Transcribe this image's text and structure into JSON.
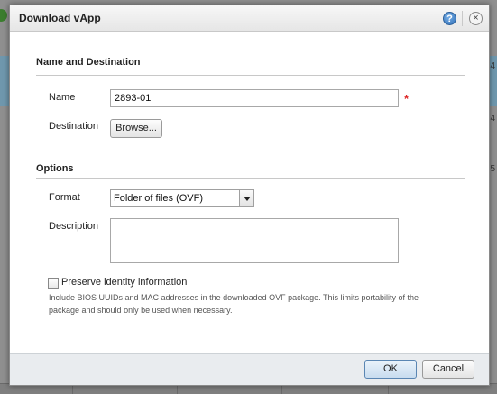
{
  "background": {
    "edge_values": [
      "4",
      "4",
      "5"
    ]
  },
  "dialog": {
    "title": "Download vApp",
    "help_icon": "?",
    "close_icon": "×"
  },
  "name_destination": {
    "heading": "Name and Destination",
    "name_label": "Name",
    "name_value": "2893-01",
    "required_marker": "*",
    "destination_label": "Destination",
    "browse_label": "Browse..."
  },
  "options": {
    "heading": "Options",
    "format_label": "Format",
    "format_value": "Folder of files (OVF)",
    "description_label": "Description",
    "description_value": "",
    "preserve_label": "Preserve identity information",
    "preserve_checked": false,
    "preserve_help": "Include BIOS UUIDs and MAC addresses in the downloaded OVF package. This limits portability of the package and should only be used when necessary."
  },
  "footer": {
    "ok_label": "OK",
    "cancel_label": "Cancel"
  },
  "colors": {
    "required": "#d22222",
    "ok_border": "#5a86b3",
    "footer_bg": "#e9ecef"
  }
}
